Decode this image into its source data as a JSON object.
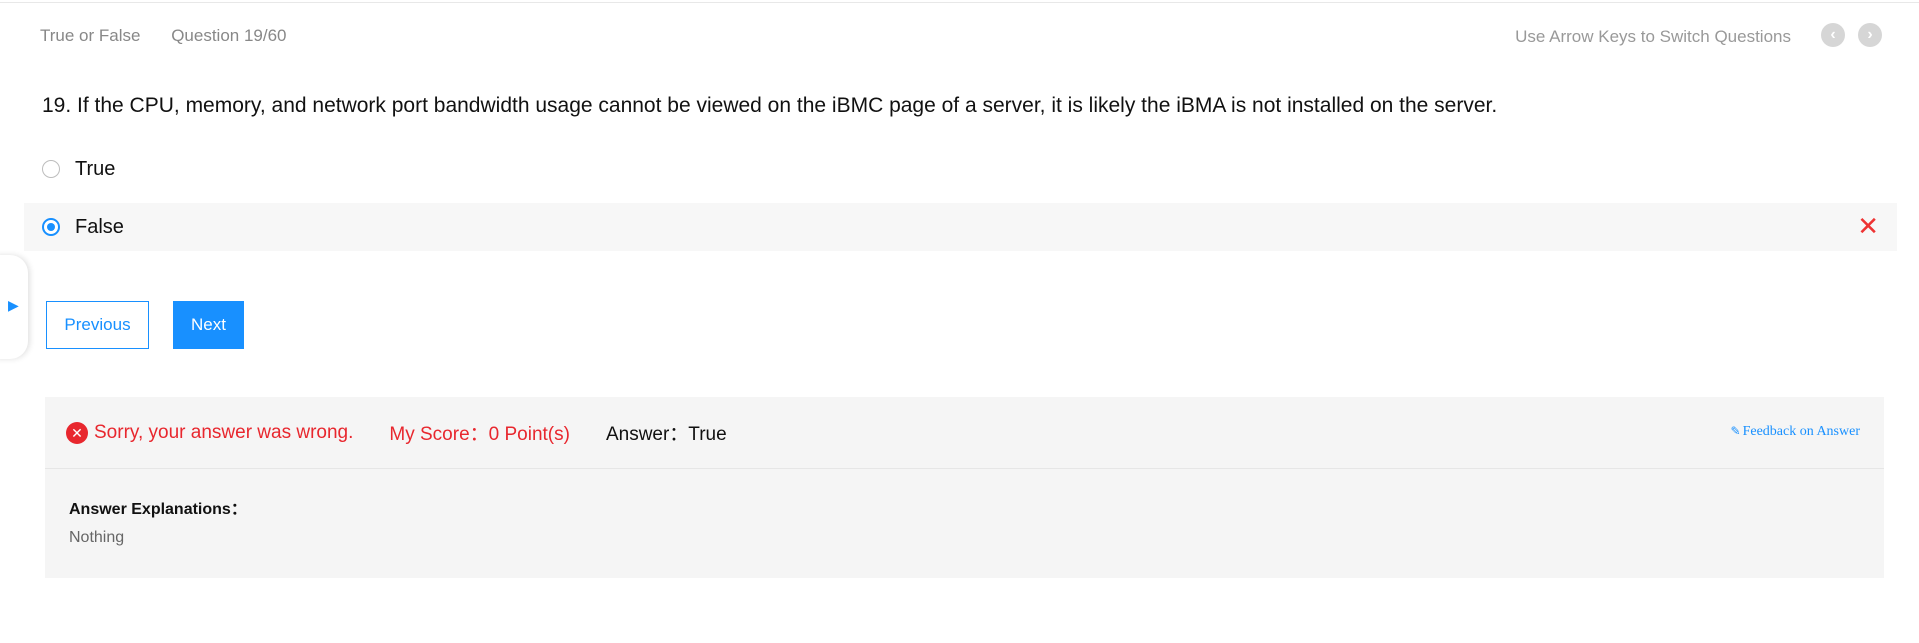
{
  "header": {
    "question_type": "True or False",
    "question_counter": "Question 19/60",
    "nav_hint": "Use Arrow Keys to Switch Questions",
    "prev_icon": "chevron-left-icon",
    "next_icon": "chevron-right-icon"
  },
  "question": {
    "text": "19. If the CPU, memory, and network port bandwidth usage cannot be viewed on the iBMC page of a server, it is likely the iBMA is not installed on the server."
  },
  "options": [
    {
      "label": "True",
      "selected": false
    },
    {
      "label": "False",
      "selected": true,
      "marked_wrong": true
    }
  ],
  "buttons": {
    "previous": "Previous",
    "next": "Next"
  },
  "result": {
    "message": "Sorry, your answer was wrong.",
    "score": "My Score：0 Point(s)",
    "answer": "Answer：True",
    "feedback_link": "Feedback on Answer",
    "explanation_title": "Answer Explanations：",
    "explanation_body": "Nothing"
  },
  "colors": {
    "accent": "#1890ff",
    "error": "#e8272e",
    "panel_bg": "#f5f5f5"
  }
}
